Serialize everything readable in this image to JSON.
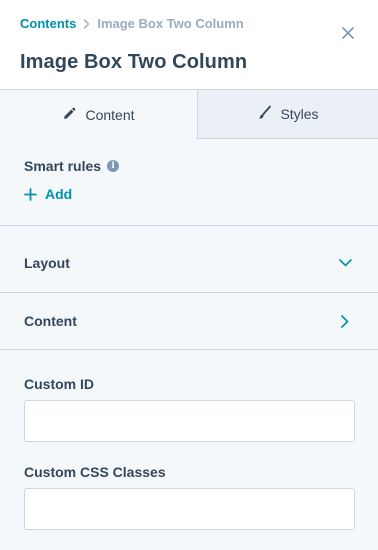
{
  "header": {
    "breadcrumb": {
      "parent": "Contents",
      "current": "Image Box Two Column"
    },
    "title": "Image Box Two Column"
  },
  "tabs": [
    {
      "label": "Content",
      "icon": "pencil-icon",
      "active": true
    },
    {
      "label": "Styles",
      "icon": "brush-icon",
      "active": false
    }
  ],
  "smart_rules": {
    "label": "Smart rules",
    "info_icon": "i",
    "add_label": "Add"
  },
  "sections": [
    {
      "label": "Layout",
      "state": "expanded"
    },
    {
      "label": "Content",
      "state": "collapsed"
    }
  ],
  "fields": {
    "custom_id": {
      "label": "Custom ID",
      "value": ""
    },
    "custom_css": {
      "label": "Custom CSS Classes",
      "value": ""
    }
  },
  "colors": {
    "accent": "#0091ae",
    "text": "#33475b",
    "muted": "#99acc2",
    "panel_bg": "#f5f8fa",
    "inactive_tab_bg": "#eaf0f6",
    "border": "#cbd6e2"
  }
}
